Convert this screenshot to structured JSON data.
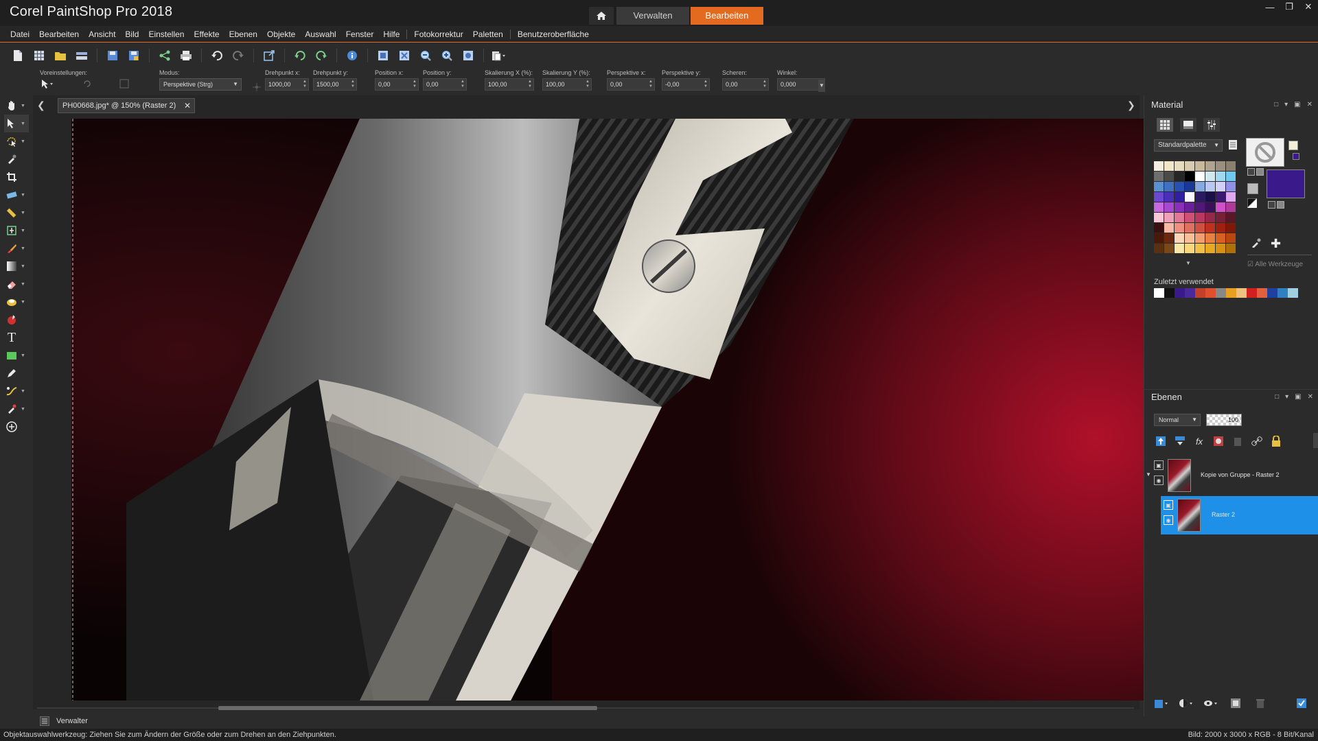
{
  "app": {
    "title": "Corel PaintShop Pro 2018",
    "workspace_tabs": [
      {
        "label": "Verwalten",
        "active": false
      },
      {
        "label": "Bearbeiten",
        "active": true
      }
    ],
    "accent_color": "#e46a1f"
  },
  "menu": [
    "Datei",
    "Bearbeiten",
    "Ansicht",
    "Bild",
    "Einstellen",
    "Effekte",
    "Ebenen",
    "Objekte",
    "Auswahl",
    "Fenster",
    "Hilfe",
    "Fotokorrektur",
    "Paletten",
    "Benutzeroberfläche"
  ],
  "options": {
    "presets_label": "Voreinstellungen:",
    "mode_label": "Modus:",
    "mode_value": "Perspektive (Strg)",
    "fields": [
      {
        "label": "Drehpunkt x:",
        "value": "1000,00"
      },
      {
        "label": "Drehpunkt y:",
        "value": "1500,00"
      },
      {
        "label": "Position x:",
        "value": "0,00"
      },
      {
        "label": "Position y:",
        "value": "0,00"
      },
      {
        "label": "Skalierung X (%):",
        "value": "100,00"
      },
      {
        "label": "Skalierung Y (%):",
        "value": "100,00"
      },
      {
        "label": "Perspektive x:",
        "value": "0,00"
      },
      {
        "label": "Perspektive y:",
        "value": "-0,00"
      },
      {
        "label": "Scheren:",
        "value": "0,00"
      },
      {
        "label": "Winkel:",
        "value": "0,000"
      }
    ]
  },
  "document": {
    "tab_label": "PH00668.jpg* @ 150% (Raster 2)"
  },
  "material": {
    "title": "Material",
    "palette_select": "Standardpalette",
    "recent_label": "Zuletzt verwendet",
    "all_tools_label": "Alle Werkzeuge",
    "swatches": [
      "#f5efe0",
      "#f2e6c8",
      "#e8dcc0",
      "#d8cbb0",
      "#c8b89c",
      "#b0a490",
      "#9a9080",
      "#8a8070",
      "#6e6e6e",
      "#4a4a4a",
      "#262626",
      "#000000",
      "#ffffff",
      "#d0e8f0",
      "#a0d8f0",
      "#70c8f0",
      "#5890d0",
      "#4070c0",
      "#2850b0",
      "#1a3898",
      "#88a8e0",
      "#b8c8f0",
      "#d0d0f8",
      "#9090e8",
      "#6a48d0",
      "#4a30b8",
      "#3020a0",
      "#f8f8ff",
      "#2a1a60",
      "#1a1048",
      "#3a1a70",
      "#e0a8f0",
      "#c868e0",
      "#a848d0",
      "#8830b8",
      "#6a2098",
      "#501878",
      "#3a1058",
      "#d050c8",
      "#b03898",
      "#f8c8d8",
      "#f0a0b8",
      "#e07898",
      "#d05078",
      "#b83860",
      "#982848",
      "#782038",
      "#581828",
      "#3a1010",
      "#f8b8a8",
      "#f09080",
      "#e07060",
      "#d05040",
      "#c03020",
      "#a02010",
      "#801808",
      "#4a1808",
      "#6a2810",
      "#f8d8b8",
      "#f8c098",
      "#f0a070",
      "#e88040",
      "#d86020",
      "#b84810",
      "#5a3010",
      "#7a4818",
      "#f8e8a8",
      "#f8d878",
      "#f0c048",
      "#e8a820",
      "#d89010",
      "#b07008"
    ],
    "recent": [
      "#ffffff",
      "#111111",
      "#3a1a8a",
      "#4a2a9a",
      "#c0402a",
      "#e05030",
      "#888888",
      "#e8a020",
      "#f0c080",
      "#d02020",
      "#e06040",
      "#2040a0",
      "#3080c0",
      "#a0d0e0"
    ],
    "foreground_color": "#f5efd8",
    "background_color": "#3a1a8a"
  },
  "layers": {
    "title": "Ebenen",
    "blend_mode": "Normal",
    "opacity": "100",
    "items": [
      {
        "name": "Kopie von Gruppe - Raster 2",
        "selected": false
      },
      {
        "name": "Raster 2",
        "selected": true
      }
    ]
  },
  "bottom": {
    "verwalter_label": "Verwalter",
    "status_text": "Objektauswahlwerkzeug: Ziehen Sie zum Ändern der Größe oder zum Drehen an den Ziehpunkten.",
    "status_right": "Bild:  2000 x 3000 x RGB - 8 Bit/Kanal"
  },
  "icons": {
    "toolbar": [
      "new-icon",
      "grid-icon",
      "open-icon",
      "scan-icon",
      "save-icon",
      "save-as-icon",
      "share-icon",
      "print-icon",
      "undo-icon",
      "redo-icon",
      "resize-icon",
      "rotate-left-icon",
      "rotate-right-icon",
      "info-icon",
      "fit-icon",
      "fit-window-icon",
      "zoom-out-icon",
      "zoom-in-icon",
      "actual-size-icon",
      "paste-icon"
    ],
    "tools": [
      "pan-icon",
      "pick-icon",
      "selection-icon",
      "dropper-icon",
      "crop-icon",
      "straighten-icon",
      "ruler-icon",
      "text-frame-icon",
      "brush-icon",
      "gradient-icon",
      "eraser-icon",
      "retouch-icon",
      "red-eye-icon",
      "text-icon",
      "shape-icon",
      "pen-icon",
      "warp-icon",
      "clone-icon",
      "add-icon"
    ]
  }
}
